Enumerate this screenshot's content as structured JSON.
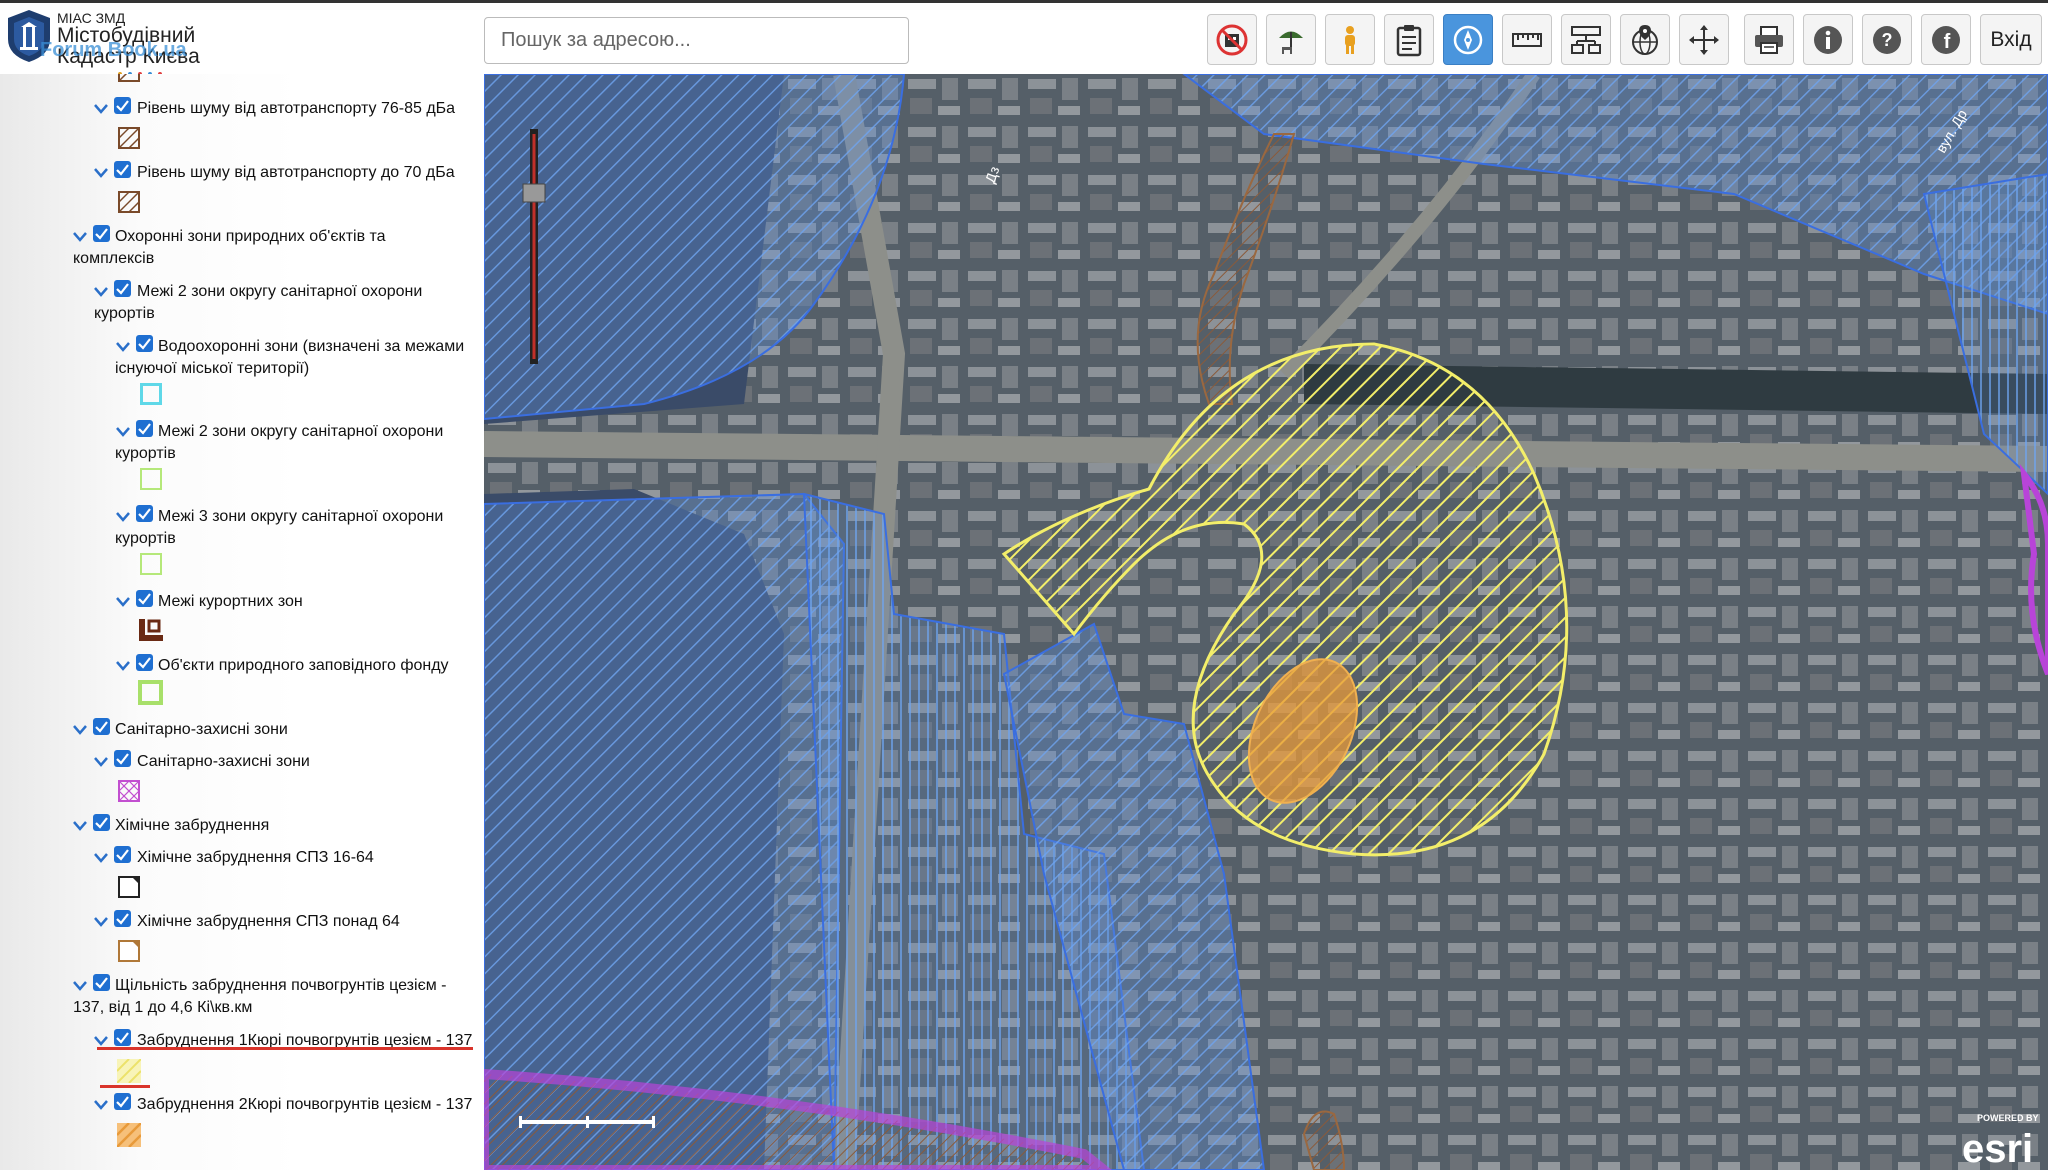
{
  "header": {
    "brand_small": "МІАС ЗМД",
    "brand_line1": "Містобудівний",
    "brand_line2": "Кадастр Києва",
    "watermark": "Forum Book.ua",
    "search_placeholder": "Пошук за адресою...",
    "login_label": "Вхід"
  },
  "toolbar": {
    "icons": [
      "no-building-icon",
      "beach-umbrella-icon",
      "person-icon",
      "clipboard-icon",
      "compass-icon",
      "ruler-icon",
      "network-icon",
      "globe-pin-icon",
      "move-icon",
      "printer-icon",
      "info-icon",
      "help-icon",
      "facebook-icon"
    ],
    "active": "compass-icon"
  },
  "layers": {
    "noise_76_85": "Рівень шуму від автотранспорту 76-85 дБа",
    "noise_70": "Рівень шуму від автотранспорту до 70 дБа",
    "protected_natural_1": "Охоронні зони природних об'єктів та",
    "protected_natural_2": "комплексів",
    "sanitary_2_zone_1": "Межі 2 зони округу санітарної охорони",
    "sanitary_2_zone_2": "курортів",
    "water_protection_1": "Водоохоронні зони (визначені за межами",
    "water_protection_2": "існуючої міської території)",
    "sanitary_2_zone_b_1": "Межі 2 зони округу санітарної охорони",
    "sanitary_2_zone_b_2": "курортів",
    "sanitary_3_zone_1": "Межі 3 зони округу санітарної охорони",
    "sanitary_3_zone_2": "курортів",
    "resort_zones": "Межі курортних зон",
    "nature_reserve": "Об'єкти природного заповідного фонду",
    "sanitary_protection_group": "Санітарно-захисні зони",
    "sanitary_protection": "Санітарно-захисні зони",
    "chemical_group": "Хімічне забруднення",
    "chemical_16_64": "Хімічне забруднення СПЗ 16-64",
    "chemical_over_64": "Хімічне забруднення СПЗ понад 64",
    "cesium_density_1": "Щільність забруднення почвогрунтів цезієм -",
    "cesium_density_2": "137, від 1 до 4,6 Кі\\кв.км",
    "cesium_1": "Забруднення 1Кюрі почвогрунтів цезієм - 137",
    "cesium_2": "Забруднення 2Кюрі почвогрунтів цезієм - 137"
  },
  "map": {
    "street_label_1": "вул. Др",
    "street_label_2": "Дз",
    "attribution_small": "POWERED BY",
    "attribution": "esri"
  },
  "colors": {
    "accent": "#1f6fd1",
    "cesium_1_fill": "#f3ee6a",
    "cesium_2_fill": "#f0a040",
    "water_hatch": "#4f86e0",
    "highlight_line": "#d9342b"
  }
}
